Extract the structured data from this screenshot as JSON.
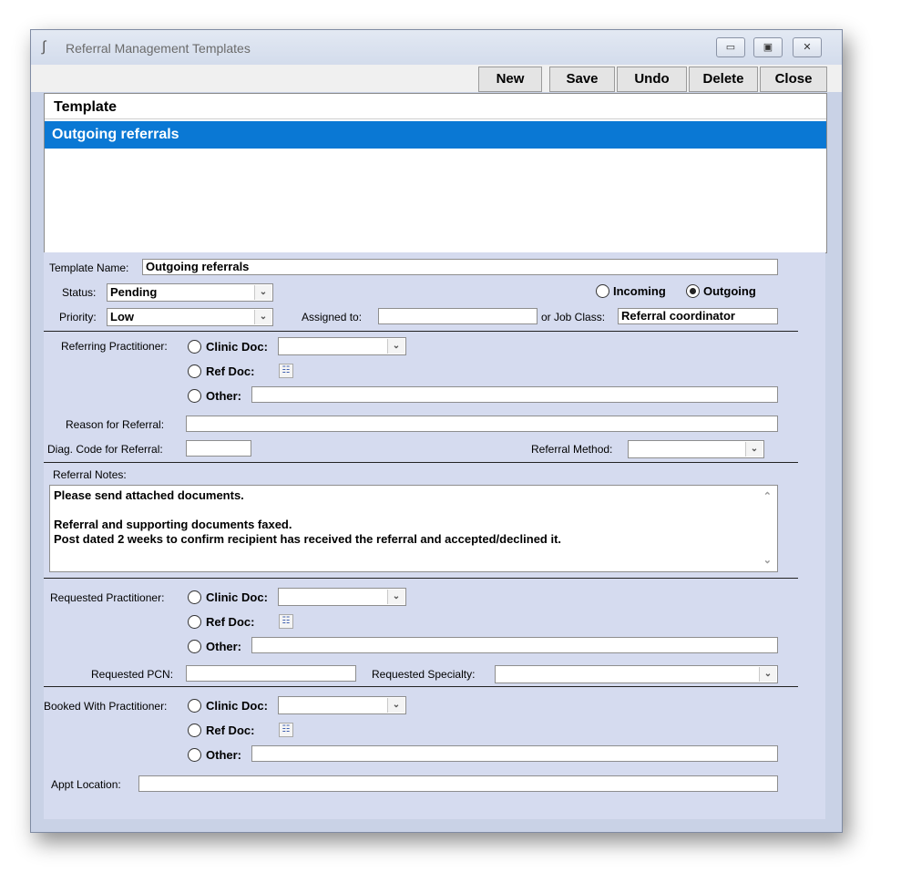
{
  "window": {
    "title": "Referral Management Templates",
    "controls": [
      "minimize",
      "maximize",
      "close"
    ]
  },
  "toolbar": {
    "new_label": "New",
    "save_label": "Save",
    "undo_label": "Undo",
    "delete_label": "Delete",
    "close_label": "Close"
  },
  "template_list": {
    "header": "Template",
    "rows": [
      "Outgoing referrals"
    ],
    "selected_color": "#0a78d4"
  },
  "form": {
    "template_name_label": "Template Name:",
    "template_name_value": "Outgoing referrals",
    "status_label": "Status:",
    "status_value": "Pending",
    "direction_incoming_label": "Incoming",
    "direction_outgoing_label": "Outgoing",
    "direction_selected": "Outgoing",
    "priority_label": "Priority:",
    "priority_value": "Low",
    "assigned_to_label": "Assigned to:",
    "assigned_to_value": "",
    "job_class_label": "or Job Class:",
    "job_class_value": "Referral coordinator",
    "referring_label": "Referring Practitioner:",
    "clinic_doc_label": "Clinic Doc:",
    "ref_doc_label": "Ref Doc:",
    "other_label": "Other:",
    "reason_label": "Reason for Referral:",
    "reason_value": "",
    "diag_label": "Diag. Code for Referral:",
    "diag_value": "",
    "method_label": "Referral Method:",
    "method_value": "",
    "notes_label": "Referral Notes:",
    "notes_lines": [
      "Please send attached documents.",
      "",
      "Referral and supporting documents faxed.",
      "Post dated 2 weeks to confirm recipient has received the referral and accepted/declined it."
    ],
    "requested_label": "Requested Practitioner:",
    "requested_pcn_label": "Requested PCN:",
    "requested_pcn_value": "",
    "requested_specialty_label": "Requested Specialty:",
    "requested_specialty_value": "",
    "booked_label": "Booked With Practitioner:",
    "appt_location_label": "Appt Location:",
    "appt_location_value": ""
  }
}
